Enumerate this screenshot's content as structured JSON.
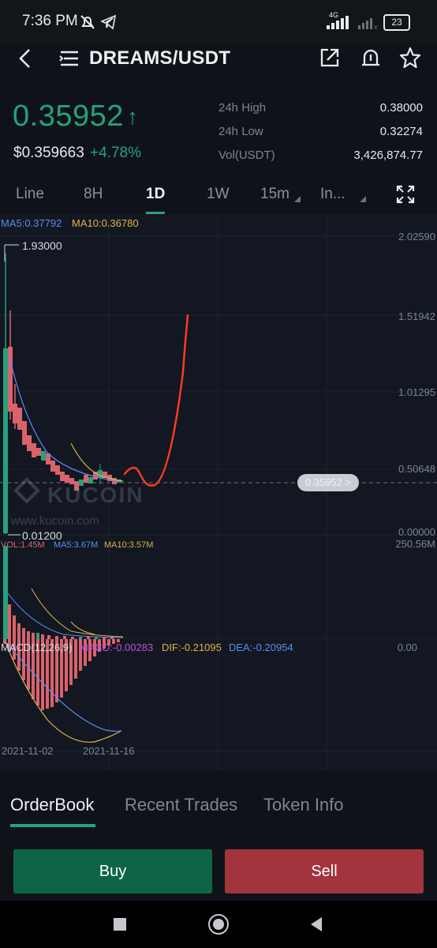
{
  "status_bar": {
    "time": "7:36 PM",
    "network": "4G",
    "battery": "23"
  },
  "header": {
    "pair": "DREAMS/USDT"
  },
  "ticker": {
    "price": "0.35952",
    "price_usd": "$0.359663",
    "change": "+4.78%",
    "stats": [
      {
        "label": "24h High",
        "value": "0.38000"
      },
      {
        "label": "24h Low",
        "value": "0.32274"
      },
      {
        "label": "Vol(USDT)",
        "value": "3,426,874.77"
      }
    ]
  },
  "timeframes": [
    "Line",
    "8H",
    "1D",
    "1W",
    "15m",
    "In..."
  ],
  "active_timeframe": "1D",
  "chart": {
    "ma_labels": {
      "ma5": "MA5:0.37792",
      "ma10": "MA10:0.36780"
    },
    "axis": [
      "2.02590",
      "1.51942",
      "1.01295",
      "0.50648",
      "0.00000"
    ],
    "high_label": "1.93000",
    "low_label": "0.01200",
    "current_price_tag": "0.35952 >",
    "watermark": "KUCOIN",
    "watermark_url": "www.kucoin.com",
    "vol_labels": {
      "vol": "VOL:1.45M",
      "ma5": "MA5:3.67M",
      "ma10": "MA10:3.57M"
    },
    "vol_axis": "250.56M",
    "macd_labels": {
      "macd_params": "MACD(12,26,9)",
      "macd": "MACD:-0.00283",
      "dif": "DIF:-0.21095",
      "dea": "DEA:-0.20954"
    },
    "macd_axis": "0.00",
    "dates": [
      "2021-11-02",
      "2021-11-16"
    ],
    "colors": {
      "up": "#26a17b",
      "down": "#d9626b",
      "ma5": "#5b8def",
      "ma10": "#e0b24a",
      "macd": "#c24fd6",
      "annotation": "#ff3b1f"
    }
  },
  "bottom_tabs": [
    "OrderBook",
    "Recent Trades",
    "Token Info"
  ],
  "actions": {
    "buy": "Buy",
    "sell": "Sell"
  }
}
